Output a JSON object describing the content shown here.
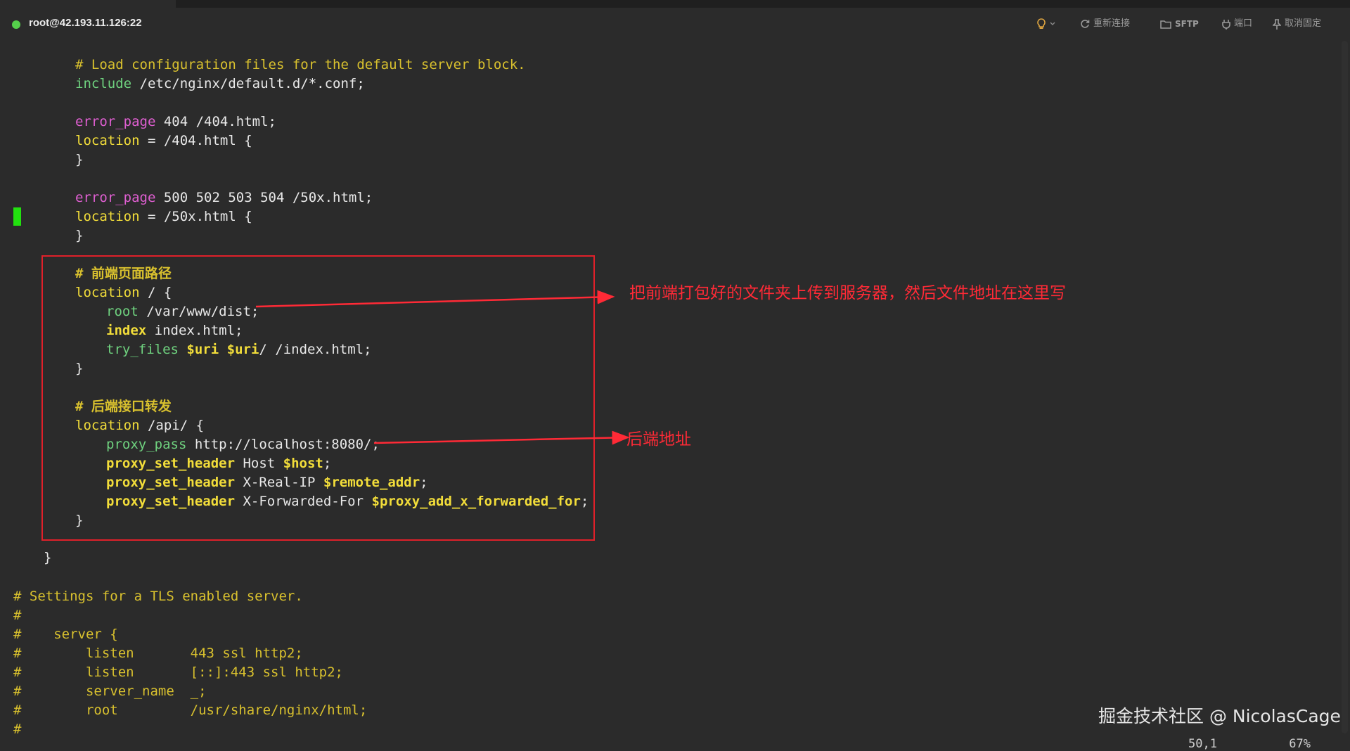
{
  "session": {
    "title": "root@42.193.11.126:22",
    "status_color": "#55d04b"
  },
  "toolbar": {
    "reconnect": "重新连接",
    "sftp": "SFTP",
    "port": "端口",
    "unpin": "取消固定",
    "icons": [
      "lightbulb-icon",
      "chevron-down-icon",
      "refresh-icon",
      "folder-icon",
      "plug-icon",
      "pin-icon"
    ]
  },
  "code": {
    "l1": {
      "comment": "# Load configuration files for the default server block."
    },
    "l2": {
      "kw": "include",
      "rest": " /etc/nginx/default.d/*.conf;"
    },
    "l4": {
      "kw": "error_page",
      "rest": " 404 /404.html;"
    },
    "l5": {
      "kw": "location",
      "rest": " = /404.html {"
    },
    "l6": {
      "rest": "}"
    },
    "l8": {
      "kw": "error_page",
      "rest": " 500 502 503 504 /50x.html;"
    },
    "l9": {
      "kw": "location",
      "rest": " = /50x.html {"
    },
    "l10": {
      "rest": "}"
    },
    "l12": {
      "comment": "# 前端页面路径"
    },
    "l13": {
      "kw": "location",
      "rest": " / {"
    },
    "l14": {
      "kw": "root",
      "rest": " /var/www/dist;"
    },
    "l15": {
      "kw": "index",
      "rest": " index.html;"
    },
    "l16": {
      "kw": "try_files",
      "v1": "$uri",
      "sp1": " ",
      "v2": "$uri",
      "rest": "/ /index.html;"
    },
    "l17": {
      "rest": "}"
    },
    "l19": {
      "comment": "# 后端接口转发"
    },
    "l20": {
      "kw": "location",
      "rest": " /api/ {"
    },
    "l21": {
      "kw": "proxy_pass",
      "rest": " http://localhost:8080/;"
    },
    "l22": {
      "kw": "proxy_set_header",
      "rest": " Host ",
      "v1": "$host",
      "end": ";"
    },
    "l23": {
      "kw": "proxy_set_header",
      "rest": " X-Real-IP ",
      "v1": "$remote_addr",
      "end": ";"
    },
    "l24": {
      "kw": "proxy_set_header",
      "rest": " X-Forwarded-For ",
      "v1": "$proxy_add_x_forwarded_for",
      "end": ";"
    },
    "l25": {
      "rest": "}"
    },
    "l27": {
      "rest": "}"
    },
    "l29": {
      "comment": "# Settings for a TLS enabled server."
    },
    "l30": {
      "comment": "#"
    },
    "l31": {
      "comment": "#    server {"
    },
    "l32": {
      "comment": "#        listen       443 ssl http2;"
    },
    "l33": {
      "comment": "#        listen       [::]:443 ssl http2;"
    },
    "l34": {
      "comment": "#        server_name  _;"
    },
    "l35": {
      "comment": "#        root         /usr/share/nginx/html;"
    },
    "l36": {
      "comment": "#"
    }
  },
  "annotations": {
    "frontend": "把前端打包好的文件夹上传到服务器，然后文件地址在这里写",
    "backend": "后端地址",
    "color": "#ff2a36"
  },
  "watermark": "掘金技术社区 @ NicolasCage",
  "statusbar": "50,1          67%"
}
